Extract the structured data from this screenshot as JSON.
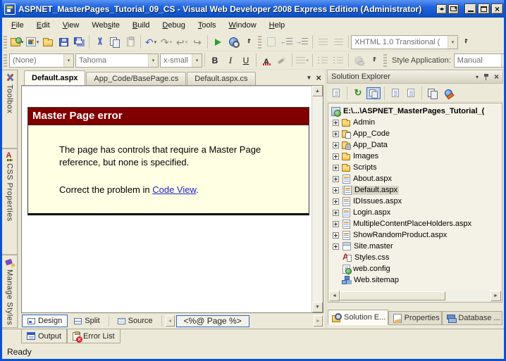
{
  "window": {
    "title": "ASPNET_MasterPages_Tutorial_09_CS - Visual Web Developer 2008 Express Edition (Administrator)"
  },
  "menu": {
    "items": [
      {
        "label": "File",
        "accel": 0
      },
      {
        "label": "Edit",
        "accel": 0
      },
      {
        "label": "View",
        "accel": 0
      },
      {
        "label": "Website",
        "accel": 3
      },
      {
        "label": "Build",
        "accel": 0
      },
      {
        "label": "Debug",
        "accel": 0
      },
      {
        "label": "Tools",
        "accel": 0
      },
      {
        "label": "Window",
        "accel": 0
      },
      {
        "label": "Help",
        "accel": 0
      }
    ]
  },
  "toolbars": {
    "doctype_value": "XHTML 1.0 Transitional (",
    "style_combo": "(None)",
    "font_combo": "Tahoma",
    "size_combo": "x-small",
    "bold_label": "B",
    "italic_label": "I",
    "underline_label": "U",
    "style_application_label": "Style Application:",
    "style_application_value": "Manual"
  },
  "icons": {
    "new_website": "folder + green globe + dropdown",
    "add_new_item": "sparkle grid + dropdown",
    "open_file": "yellow folder",
    "save": "blue floppy",
    "save_all": "stacked floppies",
    "cut": "scissors",
    "copy": "two pages",
    "paste": "clipboard (disabled)",
    "undo": "curved arrow left + dropdown",
    "redo": "curved arrow right (disabled) + dropdown",
    "navigate_backward": "page arrow left (disabled) + dropdown",
    "navigate_forward": "page arrow right (disabled)",
    "start_debugging": "green play triangle",
    "view_in_browser": "globe + magnifier",
    "refresh": "green circular arrow",
    "nest_related_files": "two pages (pressed state)",
    "aspnet_configuration": "globe + wrench"
  },
  "side_tabs": [
    "Toolbox",
    "CSS Properties",
    "Manage Styles"
  ],
  "editor": {
    "tabs": [
      "Default.aspx",
      "App_Code/BasePage.cs",
      "Default.aspx.cs"
    ],
    "error": {
      "title": "Master Page error",
      "body": "The page has controls that require a Master Page reference, but none is specified.",
      "fix_prefix": "Correct the problem in ",
      "fix_link": "Code View",
      "fix_suffix": "."
    },
    "views": [
      "Design",
      "Split",
      "Source"
    ],
    "tag_navigator": "<%@ Page %>"
  },
  "solution_explorer": {
    "title": "Solution Explorer",
    "root": "E:\\...\\ASPNET_MasterPages_Tutorial_(",
    "items": [
      {
        "label": "Admin",
        "type": "folder"
      },
      {
        "label": "App_Code",
        "type": "folder-code"
      },
      {
        "label": "App_Data",
        "type": "folder-data"
      },
      {
        "label": "Images",
        "type": "folder"
      },
      {
        "label": "Scripts",
        "type": "folder"
      },
      {
        "label": "About.aspx",
        "type": "page"
      },
      {
        "label": "Default.aspx",
        "type": "page",
        "selected": true
      },
      {
        "label": "IDIssues.aspx",
        "type": "page"
      },
      {
        "label": "Login.aspx",
        "type": "page"
      },
      {
        "label": "MultipleContentPlaceHolders.aspx",
        "type": "page"
      },
      {
        "label": "ShowRandomProduct.aspx",
        "type": "page"
      },
      {
        "label": "Site.master",
        "type": "master"
      },
      {
        "label": "Styles.css",
        "type": "css"
      },
      {
        "label": "web.config",
        "type": "config"
      },
      {
        "label": "Web.sitemap",
        "type": "sitemap"
      }
    ],
    "tabs": [
      "Solution E...",
      "Properties",
      "Database ..."
    ]
  },
  "bottom": {
    "tabs": [
      "Output",
      "Error List"
    ],
    "status": "Ready"
  },
  "colors": {
    "titlebar_blue": "#1E5FD6",
    "chrome": "#ECE9D8",
    "error_header_bg": "#800000",
    "error_body_bg": "#FEFFE3",
    "link_blue": "#2222CC",
    "selection_border_blue": "#316AC5"
  }
}
